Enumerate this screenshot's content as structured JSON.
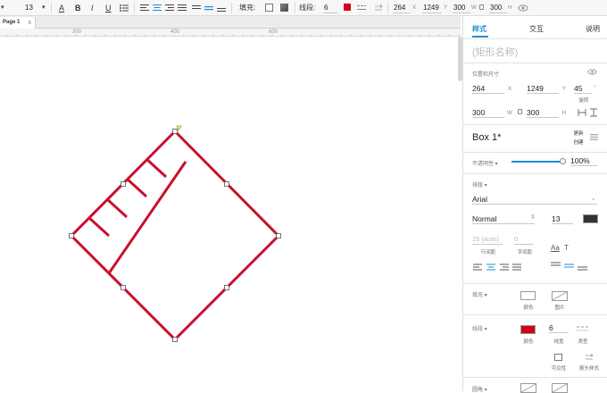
{
  "toolbar": {
    "font_size": "13",
    "fill_label": "填充:",
    "line_label": "线段:",
    "line_width": "6",
    "x": "264",
    "x_unit": "X",
    "y": "1249",
    "y_unit": "Y",
    "w": "300",
    "w_unit": "W",
    "h": "300",
    "h_unit": "H"
  },
  "tabs": {
    "page": "Page 1",
    "close": "x"
  },
  "ruler": {
    "marks": [
      "200",
      "400",
      "600"
    ]
  },
  "colors": {
    "accent": "#1a8fd5",
    "stroke": "#c8102e",
    "fill_swatch": "#d0021b",
    "text_swatch": "#333333"
  },
  "panel": {
    "tabs": {
      "style": "样式",
      "interact": "交互",
      "notes": "说明"
    },
    "shape_name_placeholder": "(矩形名称)",
    "position_size_label": "位置和尺寸",
    "x": "264",
    "x_unit": "X",
    "y": "1249",
    "y_unit": "Y",
    "rotation": "45",
    "rotation_unit": "°",
    "rotation_label": "旋转",
    "w": "300",
    "w_unit": "W",
    "h": "300",
    "h_unit": "H",
    "style_name": "Box 1*",
    "update_label": "更新",
    "create_label": "创建",
    "opacity_label": "不透明性",
    "opacity_value": "100%",
    "opacity_fraction": 1.0,
    "font_section_label": "排版",
    "font_family": "Arial",
    "font_weight": "Normal",
    "font_size": "13",
    "line_height_value": "15 (auto)",
    "letter_spacing_value": "0",
    "line_height_label": "行间距",
    "letter_spacing_label": "字间距",
    "fill_section_label": "填充",
    "fill_color_label": "颜色",
    "fill_image_label": "图片",
    "line_section_label": "线段",
    "line_color_label": "颜色",
    "line_width_value": "6",
    "line_width_label": "线宽",
    "line_type_label": "类型",
    "visibility_label": "可见性",
    "arrow_style_label": "箭头样式",
    "corner_section_label": "圆角"
  }
}
